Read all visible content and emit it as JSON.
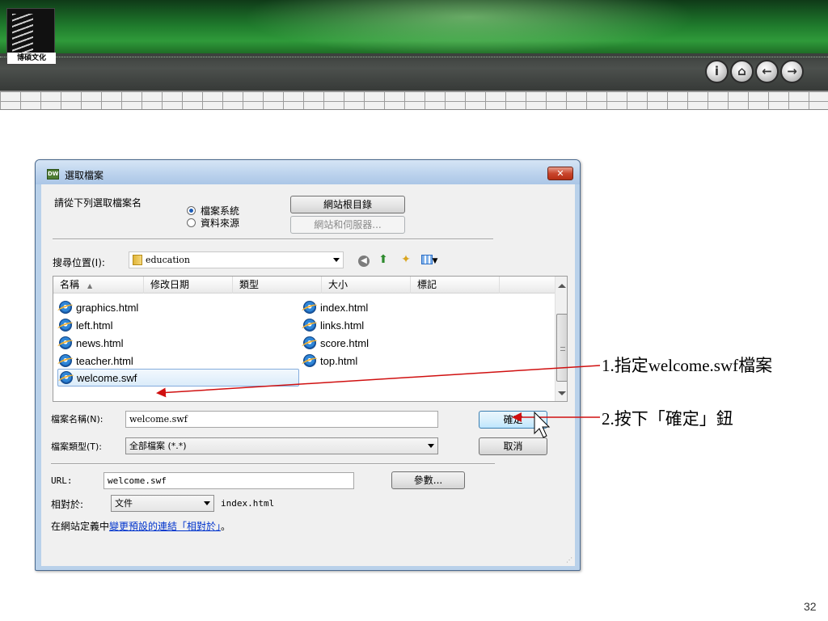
{
  "slide": {
    "logo_text": "博碩文化",
    "nav_buttons": [
      {
        "icon": "info-icon",
        "glyph": "i"
      },
      {
        "icon": "home-icon",
        "glyph": "⌂"
      },
      {
        "icon": "back-icon",
        "glyph": "←"
      },
      {
        "icon": "forward-icon",
        "glyph": "→"
      }
    ],
    "page_number": "32"
  },
  "dialog": {
    "app_icon_text": "DW",
    "title": "選取檔案",
    "close_glyph": "✕",
    "select_from_label": "請從下列選取檔案名",
    "source_options": [
      {
        "label": "檔案系統",
        "selected": true
      },
      {
        "label": "資料來源",
        "selected": false
      }
    ],
    "site_root_button": "網站根目錄",
    "site_server_button": "網站和伺服器...",
    "look_in_label": "搜尋位置(I):",
    "look_in_value": "education",
    "toolbar_icons": [
      "back-icon",
      "up-folder-icon",
      "new-folder-icon",
      "view-menu-icon"
    ],
    "columns": [
      "名稱",
      "修改日期",
      "類型",
      "大小",
      "標記"
    ],
    "files_left": [
      "graphics.html",
      "left.html",
      "news.html",
      "teacher.html",
      "welcome.swf"
    ],
    "files_right": [
      "index.html",
      "links.html",
      "score.html",
      "top.html"
    ],
    "selected_file": "welcome.swf",
    "filename_label": "檔案名稱(N):",
    "filename_value": "welcome.swf",
    "filetype_label": "檔案類型(T):",
    "filetype_value": "全部檔案 (*.*)",
    "ok_button": "確定",
    "cancel_button": "取消",
    "url_label": "URL:",
    "url_value": "welcome.swf",
    "params_button": "參數...",
    "relative_label": "相對於:",
    "relative_value": "文件",
    "relative_path": "index.html",
    "footer_prefix": "在網站定義中",
    "footer_link": "變更預設的連結「相對於」",
    "footer_suffix": "。"
  },
  "annotations": {
    "step1": "1.指定welcome.swf檔案",
    "step2": "2.按下「確定」鈕"
  },
  "colors": {
    "banner_green": "#2f9a3a",
    "arrow_red": "#d01010",
    "dialog_frame": "#b9d1ea",
    "link_blue": "#0033cc"
  }
}
